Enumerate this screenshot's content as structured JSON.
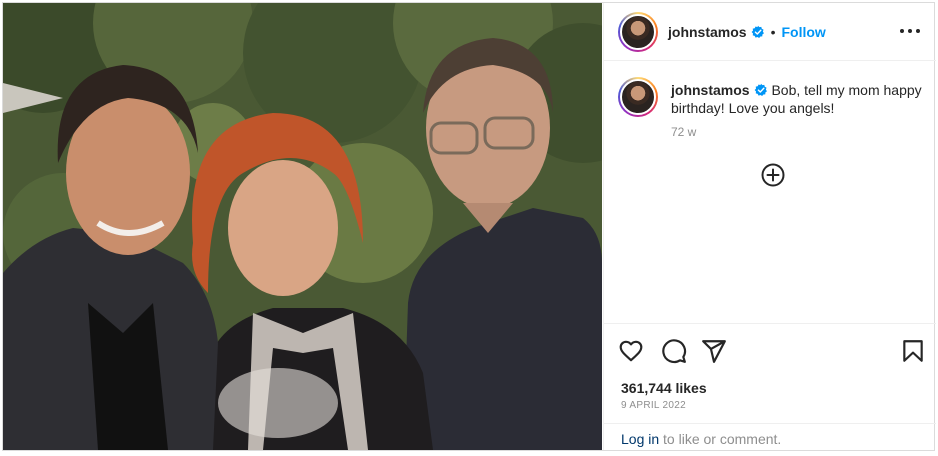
{
  "post": {
    "photo_alt": "",
    "author": {
      "username": "johnstamos",
      "verified": true,
      "avatar_icon": "profile-avatar"
    },
    "header": {
      "separator": "•",
      "follow_label": "Follow",
      "more_icon": "more-horizontal-icon"
    },
    "caption": {
      "username": "johnstamos",
      "text": "Bob, tell my mom happy birthday! Love you angels!",
      "time_ago": "72 w"
    },
    "actions": {
      "like_icon": "heart-icon",
      "comment_icon": "comment-icon",
      "share_icon": "share-icon",
      "save_icon": "bookmark-icon",
      "add_comment_icon": "plus-circle-icon"
    },
    "likes_text": "361,744 likes",
    "date_text": "9 APRIL 2022",
    "login": {
      "link_label": "Log in",
      "rest_text": " to like or comment."
    },
    "colors": {
      "follow": "#0095f6",
      "verified": "#0095f6",
      "login_link": "#00376b",
      "muted": "#8e8e8e"
    }
  }
}
